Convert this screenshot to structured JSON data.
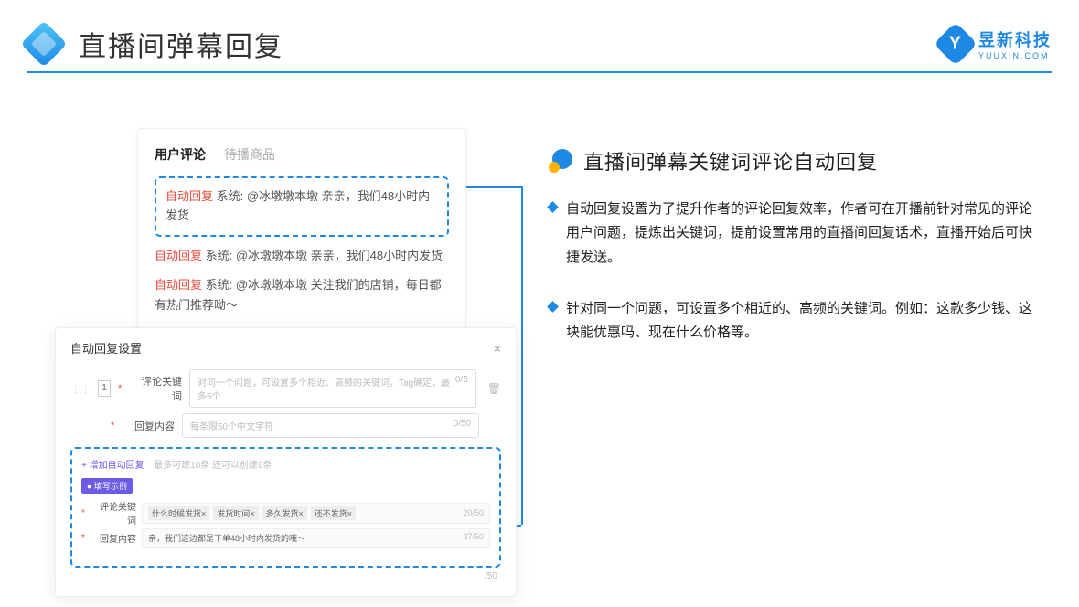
{
  "header": {
    "title": "直播间弹幕回复"
  },
  "brand": {
    "name": "昱新科技",
    "url": "YUUXIN.COM",
    "letter": "Y"
  },
  "card1": {
    "tab_active": "用户评论",
    "tab_inactive": "待播商品",
    "highlighted": {
      "label": "自动回复",
      "text": " 系统: @冰墩墩本墩 亲亲，我们48小时内发货"
    },
    "line2": {
      "label": "自动回复",
      "text": " 系统: @冰墩墩本墩 亲亲，我们48小时内发货"
    },
    "line3": {
      "label": "自动回复",
      "text": " 系统: @冰墩墩本墩 关注我们的店铺，每日都有热门推荐呦～"
    }
  },
  "card2": {
    "title": "自动回复设置",
    "num": "1",
    "kw_label": "评论关键词",
    "kw_placeholder": "对同一个问题，可设置多个相近、高频的关键词，Tag确定，最多5个",
    "kw_counter": "0/5",
    "content_label": "回复内容",
    "content_placeholder": "每条限50个中文字符",
    "content_counter": "0/50",
    "add_text": "+ 增加自动回复",
    "add_note": "最多可建10条 还可以创建9条",
    "eg_badge": "● 填写示例",
    "eg_kw_label": "评论关键词",
    "eg_tags": [
      "什么时候发货×",
      "发货时间×",
      "多久发货×",
      "还不发货×"
    ],
    "eg_kw_counter": "20/50",
    "eg_c_label": "回复内容",
    "eg_c_value": "亲，我们这边都是下单48小时内发货的哦～",
    "eg_c_counter": "37/50",
    "extra_counter": "/50"
  },
  "right": {
    "title": "直播间弹幕关键词评论自动回复",
    "p1": "自动回复设置为了提升作者的评论回复效率，作者可在开播前针对常见的评论用户问题，提炼出关键词，提前设置常用的直播间回复话术，直播开始后可快捷发送。",
    "p2": "针对同一个问题，可设置多个相近的、高频的关键词。例如：这款多少钱、这块能优惠吗、现在什么价格等。"
  }
}
